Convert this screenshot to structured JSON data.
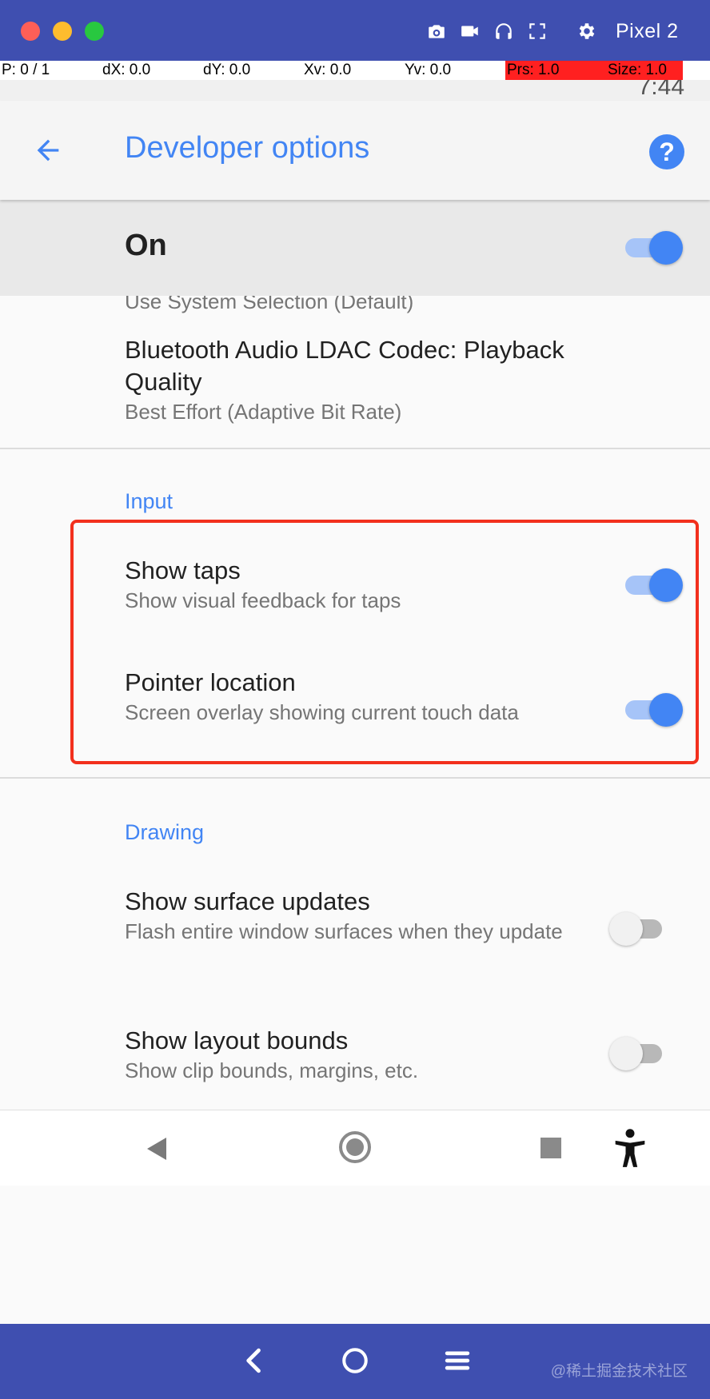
{
  "emulator": {
    "device_name": "Pixel 2",
    "toolbar_icons": [
      "camera-icon",
      "video-icon",
      "headphones-icon",
      "fullscreen-icon",
      "gear-icon"
    ],
    "bottom_controls": [
      "back-icon",
      "home-icon",
      "menu-icon"
    ],
    "watermark": "@稀土掘金技术社区"
  },
  "pointer_overlay": {
    "p": "P: 0 / 1",
    "dx": "dX: 0.0",
    "dy": "dY: 0.0",
    "xv": "Xv: 0.0",
    "yv": "Yv: 0.0",
    "prs": "Prs: 1.0",
    "size": "Size: 1.0"
  },
  "status_bar": {
    "time": "7:44"
  },
  "app_bar": {
    "title": "Developer options"
  },
  "master_switch": {
    "label": "On",
    "state": "on"
  },
  "list": {
    "partial_summary": "Use System Selection (Default)",
    "ldac": {
      "title": "Bluetooth Audio LDAC Codec: Playback Quality",
      "summary": "Best Effort (Adaptive Bit Rate)"
    },
    "input_category": "Input",
    "show_taps": {
      "title": "Show taps",
      "summary": "Show visual feedback for taps",
      "state": "on"
    },
    "pointer_location": {
      "title": "Pointer location",
      "summary": "Screen overlay showing current touch data",
      "state": "on"
    },
    "drawing_category": "Drawing",
    "surface_updates": {
      "title": "Show surface updates",
      "summary": "Flash entire window surfaces when they update",
      "state": "off"
    },
    "layout_bounds": {
      "title": "Show layout bounds",
      "summary": "Show clip bounds, margins, etc.",
      "state": "off"
    }
  },
  "colors": {
    "accent": "#4285f4",
    "highlight": "#f2301d",
    "emulator_chrome": "#3f4fb0"
  }
}
